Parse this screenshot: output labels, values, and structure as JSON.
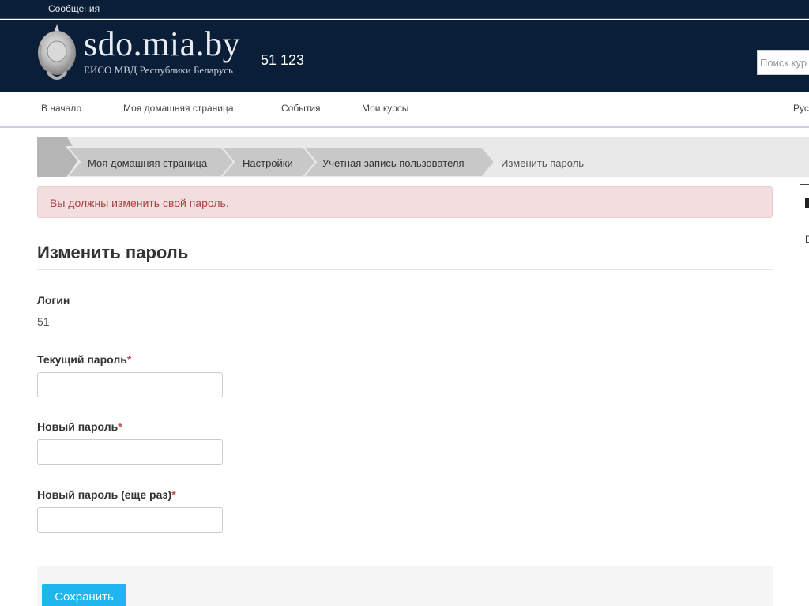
{
  "topbar": {
    "messages_label": "Сообщения"
  },
  "header": {
    "site_name": "sdo.mia.by",
    "site_subtitle": "ЕИСО МВД Республики Беларусь",
    "user_number": "51 123",
    "search_placeholder": "Поиск кур"
  },
  "nav": {
    "items": [
      {
        "label": "В начало"
      },
      {
        "label": "Моя домашняя страница"
      },
      {
        "label": "События"
      },
      {
        "label": "Мои курсы"
      }
    ],
    "language": "Рус"
  },
  "breadcrumb": {
    "items": [
      {
        "label": "Моя домашняя страница"
      },
      {
        "label": "Настройки"
      },
      {
        "label": "Учетная запись пользователя"
      },
      {
        "label": "Изменить пароль"
      }
    ]
  },
  "alert": {
    "text": "Вы должны изменить свой пароль."
  },
  "form": {
    "title": "Изменить пароль",
    "login_label": "Логин",
    "login_value": "51",
    "current_password_label": "Текущий пароль",
    "new_password_label": "Новый пароль",
    "new_password_again_label": "Новый пароль (еще раз)",
    "required_mark": "*",
    "save_label": "Сохранить"
  },
  "sidebar_fragment": {
    "letter": "В"
  }
}
